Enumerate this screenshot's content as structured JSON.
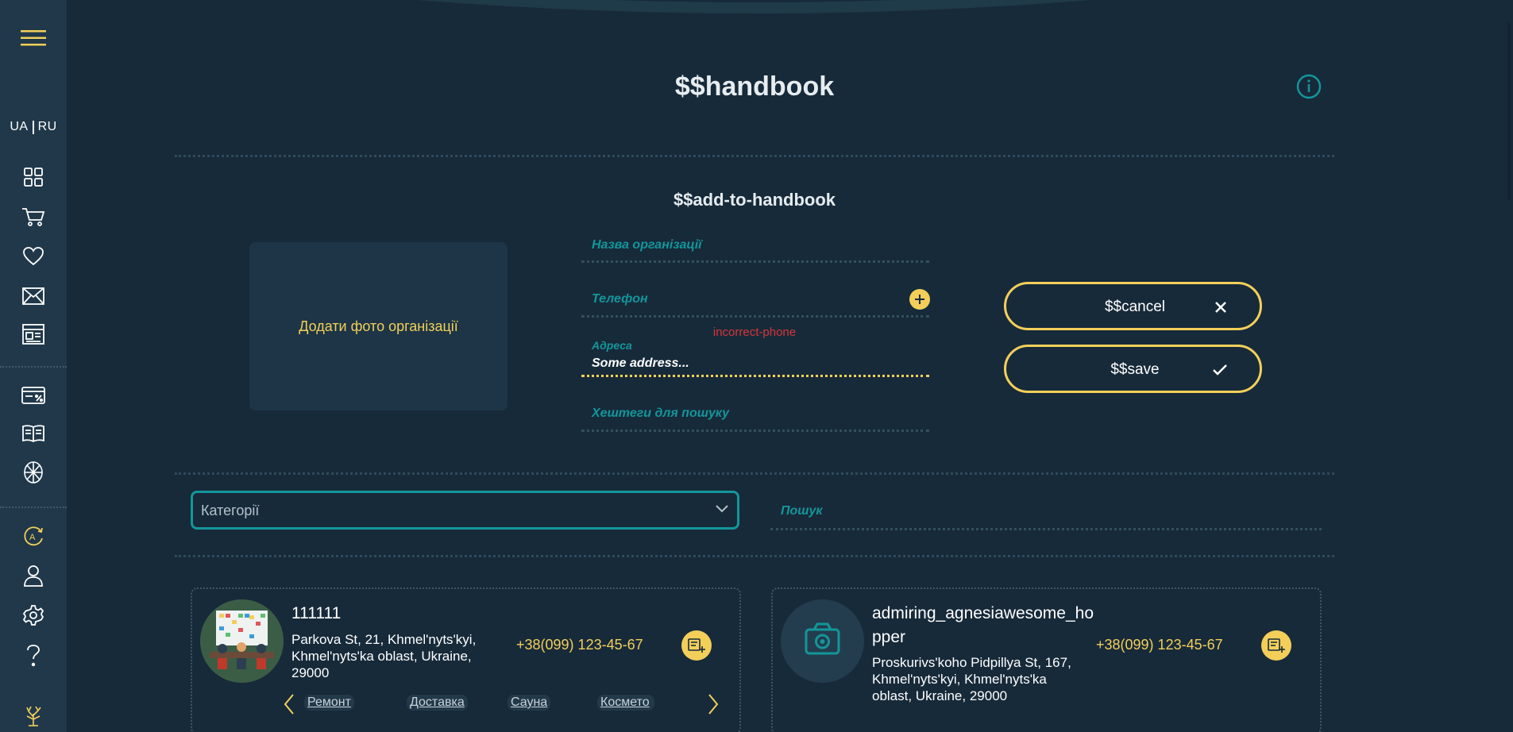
{
  "colors": {
    "background": "#172a3a",
    "sidebar": "#20384a",
    "accent_yellow": "#f3cf5a",
    "accent_teal": "#13969a",
    "error_red": "#d8353a"
  },
  "sidebar": {
    "menu_icon": "hamburger-icon",
    "lang": {
      "ua": "UA",
      "ru": "RU"
    },
    "items": [
      {
        "icon": "dashboard-icon"
      },
      {
        "icon": "cart-icon"
      },
      {
        "icon": "heart-icon"
      },
      {
        "icon": "mail-icon"
      },
      {
        "icon": "news-icon"
      },
      {
        "icon": "discount-card-icon"
      },
      {
        "icon": "handbook-icon"
      },
      {
        "icon": "flower-icon"
      },
      {
        "icon": "translate-icon"
      },
      {
        "icon": "user-icon"
      },
      {
        "icon": "settings-icon"
      },
      {
        "icon": "help-icon"
      },
      {
        "icon": "tree-icon"
      }
    ]
  },
  "header": {
    "title": "$$handbook",
    "info_icon": "info-icon"
  },
  "form": {
    "section_title": "$$add-to-handbook",
    "photo_label": "Додати фото організації",
    "name_placeholder": "Назва організації",
    "phone_placeholder": "Телефон",
    "phone_error": "incorrect-phone",
    "address_label": "Адреса",
    "address_value": "Some address...",
    "hashtags_placeholder": "Хештеги для пошуку",
    "cancel_label": "$$cancel",
    "save_label": "$$save"
  },
  "filters": {
    "categories_placeholder": "Категорії",
    "search_placeholder": "Пошук"
  },
  "cards": [
    {
      "name": "111111",
      "address": "Parkova St, 21, Khmel'nyts'kyi, Khmel'nyts'ka oblast, Ukraine, 29000",
      "phone": "+38(099) 123-45-67",
      "tags": [
        "Ремонт",
        "Доставка",
        "Сауна",
        "Космето"
      ]
    },
    {
      "name": "admiring_agnesiawesome_hopper",
      "address": "Proskurivs'koho Pidpillya St, 167, Khmel'nyts'kyi, Khmel'nyts'ka oblast, Ukraine, 29000",
      "phone": "+38(099) 123-45-67",
      "tags": []
    }
  ]
}
